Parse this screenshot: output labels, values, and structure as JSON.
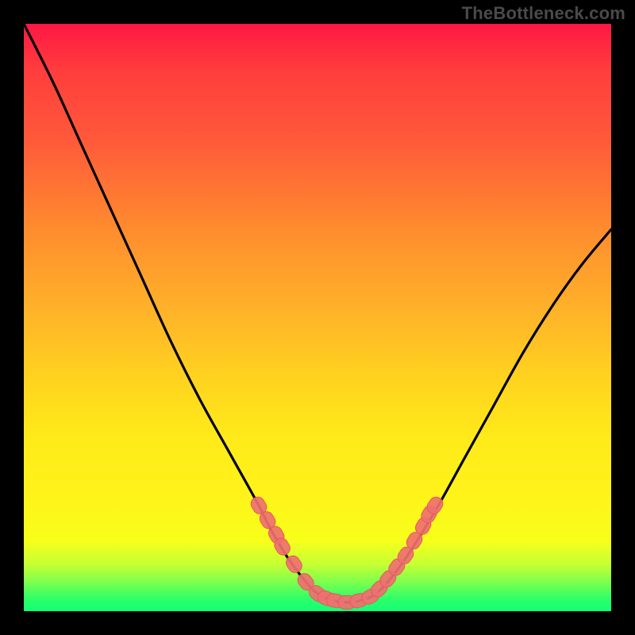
{
  "watermark": "TheBottleneck.com",
  "colors": {
    "background": "#000000",
    "gradient_top": "#ff1744",
    "gradient_mid": "#ffe91a",
    "gradient_bottom": "#13ff76",
    "curve": "#000000",
    "marker_fill": "#ef7070",
    "marker_stroke": "#e65a5a"
  },
  "chart_data": {
    "type": "line",
    "title": "",
    "xlabel": "",
    "ylabel": "",
    "xlim": [
      0,
      100
    ],
    "ylim": [
      0,
      100
    ],
    "series": [
      {
        "name": "curve",
        "x": [
          0,
          5,
          10,
          15,
          20,
          25,
          30,
          35,
          40,
          42,
          45,
          48,
          50,
          52,
          55,
          58,
          60,
          62,
          65,
          70,
          75,
          80,
          85,
          90,
          95,
          100
        ],
        "y": [
          100,
          90,
          79,
          68,
          57,
          46,
          36,
          27,
          18,
          14,
          9,
          5,
          3,
          2,
          1.5,
          2,
          3,
          5,
          9,
          17,
          26,
          35,
          44,
          52,
          59,
          65
        ]
      }
    ],
    "markers": {
      "name": "highlight",
      "style": "rounded",
      "x": [
        40,
        41.5,
        43,
        44,
        46,
        48,
        50,
        51.5,
        53,
        55,
        57,
        59,
        60.5,
        62,
        63.5,
        65,
        66.5,
        68,
        69,
        70
      ],
      "y": [
        18,
        15.5,
        13,
        11,
        8,
        5,
        3,
        2.2,
        1.8,
        1.5,
        1.8,
        2.5,
        3.8,
        5.5,
        7.5,
        9.5,
        12,
        14.5,
        16.5,
        18
      ]
    }
  }
}
